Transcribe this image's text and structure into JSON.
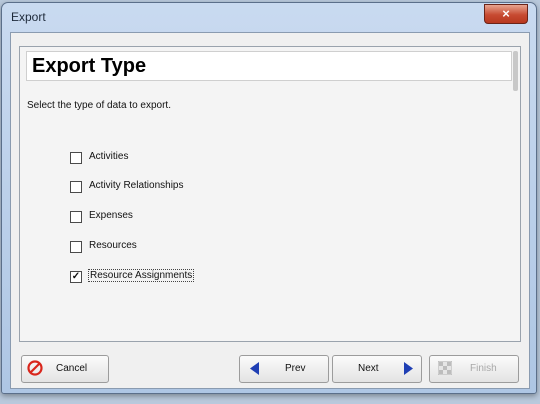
{
  "window": {
    "title": "Export",
    "close_glyph": "×"
  },
  "page": {
    "title": "Export Type",
    "instruction": "Select the type of data to export."
  },
  "options": [
    {
      "label": "Activities",
      "checked": false
    },
    {
      "label": "Activity Relationships",
      "checked": false
    },
    {
      "label": "Expenses",
      "checked": false
    },
    {
      "label": "Resources",
      "checked": false
    },
    {
      "label": "Resource Assignments",
      "checked": true
    }
  ],
  "buttons": {
    "cancel": "Cancel",
    "prev": "Prev",
    "next": "Next",
    "finish": "Finish"
  },
  "icons": {
    "cancel": "cancel-icon",
    "prev": "left-arrow-icon",
    "next": "right-arrow-icon",
    "finish": "finish-checkered-icon"
  },
  "colors": {
    "close_button": "#c74a31",
    "arrow": "#1f3fb4",
    "cancel_icon": "#d9261c"
  }
}
